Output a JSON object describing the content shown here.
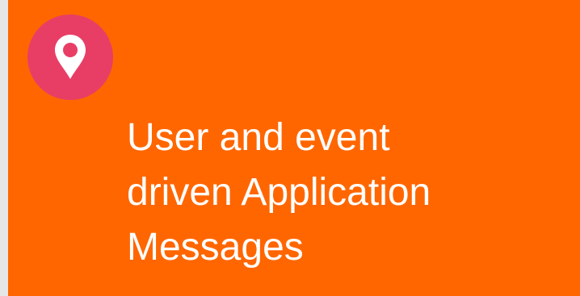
{
  "tile": {
    "background_color": "#ff6600",
    "icon": {
      "name": "map-pin-icon",
      "badge_color": "#e83e66"
    },
    "title": "User and event\ndriven Application\nMessages"
  }
}
